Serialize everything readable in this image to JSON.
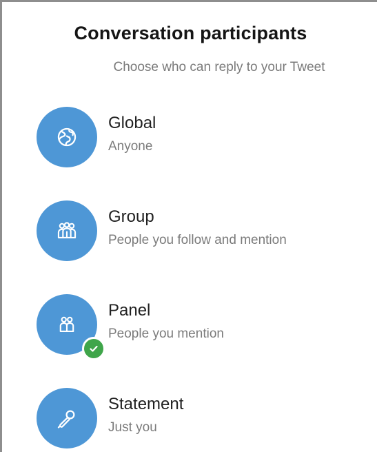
{
  "header": {
    "title": "Conversation participants",
    "subtitle": "Choose who can reply to your Tweet"
  },
  "options": [
    {
      "title": "Global",
      "subtitle": "Anyone",
      "icon": "globe-icon",
      "selected": false
    },
    {
      "title": "Group",
      "subtitle": "People you follow and mention",
      "icon": "group-icon",
      "selected": false
    },
    {
      "title": "Panel",
      "subtitle": "People you mention",
      "icon": "panel-icon",
      "selected": true
    },
    {
      "title": "Statement",
      "subtitle": "Just you",
      "icon": "microphone-icon",
      "selected": false
    }
  ],
  "colors": {
    "accent": "#4e97d6",
    "selected_check": "#3fa54a",
    "title_text": "#151515",
    "secondary_text": "#7a7a7a"
  }
}
